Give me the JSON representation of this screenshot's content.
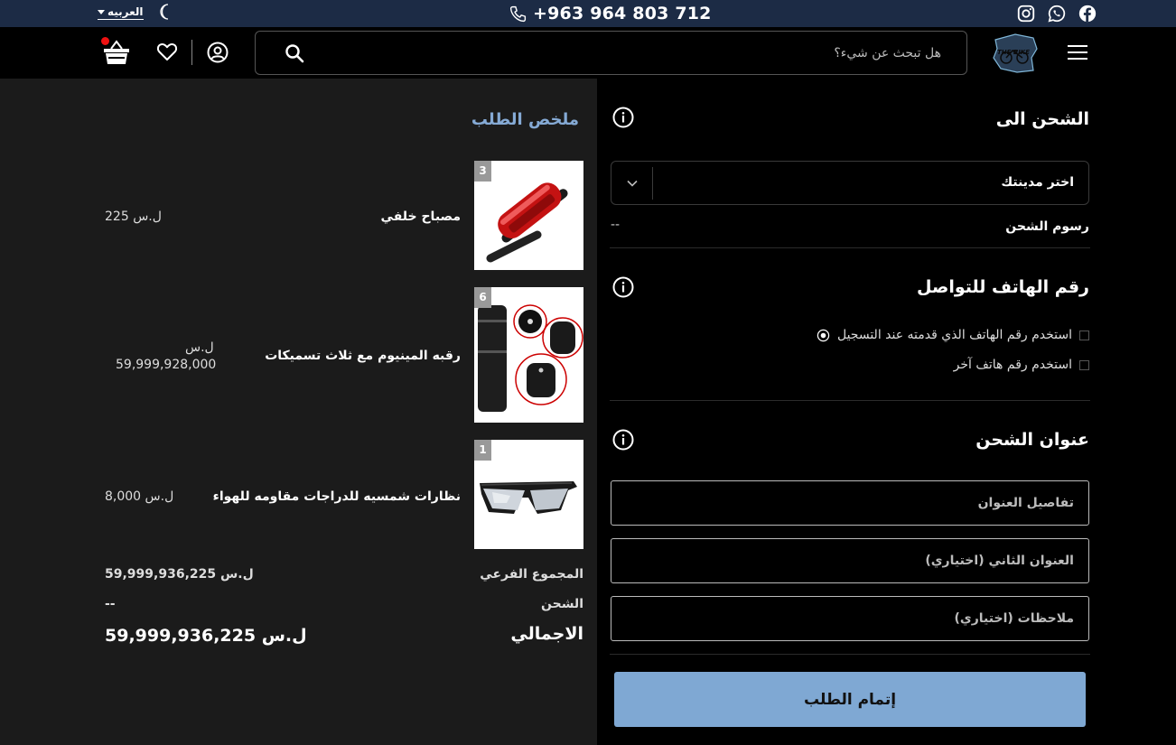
{
  "topbar": {
    "language": "العربيه",
    "phone": "+963 964 803 712",
    "social": [
      "instagram-icon",
      "whatsapp-icon",
      "facebook-icon"
    ],
    "bg_color": "#1c2b45"
  },
  "header": {
    "search_placeholder": "هل تبحث عن شيء؟",
    "logo_text": "THE BIKE"
  },
  "shipping": {
    "title": "الشحن الى",
    "city_select": "اختر مدينتك",
    "fee_label": "رسوم الشحن",
    "fee_value": "--"
  },
  "contact": {
    "title": "رقم الهاتف للتواصل",
    "option_registered": "استخدم رقم الهاتف الذي قدمته عند التسجيل",
    "option_other": "استخدم رقم هاتف آخر"
  },
  "address": {
    "title": "عنوان الشحن",
    "details_placeholder": "تفاصيل العنوان",
    "second_placeholder": "العنوان الثاني (اختياري)",
    "notes_placeholder": "ملاحظات (اختياري)"
  },
  "submit_label": "إتمام الطلب",
  "summary": {
    "title": "ملخص الطلب",
    "items": [
      {
        "qty": "3",
        "name": "مصباح خلفي",
        "currency": "ل.س",
        "price": "225"
      },
      {
        "qty": "6",
        "name": "رقبه المينيوم مع ثلاث تسميكات",
        "currency": "ل.س",
        "price": "59,999,928,000"
      },
      {
        "qty": "1",
        "name": "نظارات شمسيه للدراجات مقاومه للهواء",
        "currency": "ل.س",
        "price": "8,000"
      }
    ],
    "subtotal_label": "المجموع الفرعي",
    "subtotal_value": "59,999,936,225",
    "shipping_label": "الشحن",
    "shipping_value": "--",
    "total_label": "الاجمالي",
    "total_value": "59,999,936,225",
    "currency": "ل.س"
  },
  "colors": {
    "accent": "#7fa8d3",
    "summary_title": "#85aad5",
    "cart_badge": "#e11111"
  }
}
